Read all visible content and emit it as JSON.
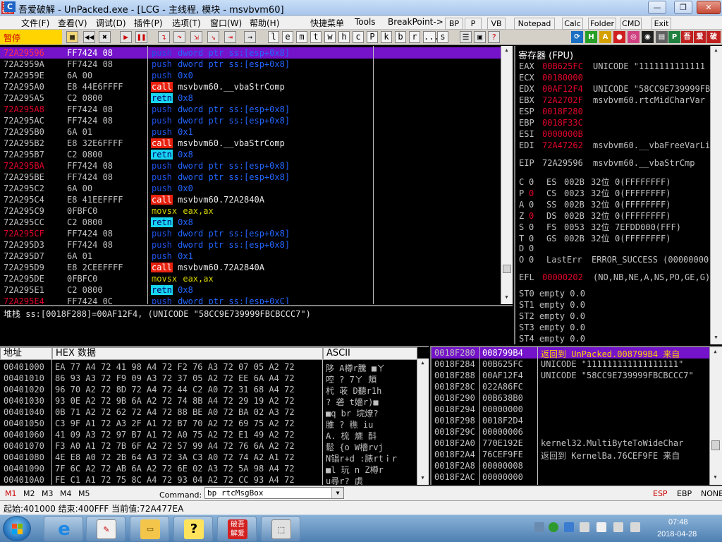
{
  "title": {
    "icon_text": "吾爱破解",
    "text": "吾爱破解 - UnPacked.exe - [LCG - 主线程, 模块 - msvbvm60]",
    "min": "—",
    "max": "❐",
    "close": "✕"
  },
  "menu": {
    "items": [
      "文件(F)",
      "查看(V)",
      "调试(D)",
      "插件(P)",
      "选项(T)",
      "窗口(W)",
      "帮助(H)",
      "快捷菜单",
      "Tools",
      "BreakPoint->"
    ],
    "plugins": [
      "BP",
      "P",
      "VB",
      "Notepad",
      "Calc",
      "Folder",
      "CMD",
      "Exit"
    ]
  },
  "toolbar": {
    "status": "暂停",
    "letters": [
      "l",
      "e",
      "m",
      "t",
      "w",
      "h",
      "c",
      "P",
      "k",
      "b",
      "r",
      "...",
      "s"
    ]
  },
  "disasm": {
    "rows": [
      {
        "addr": "72A29596",
        "bp": true,
        "sel": true,
        "hex": "FF7424 08",
        "op": "push",
        "opnd": "dword ptr ss:[esp+0x8]",
        "kind": "mem"
      },
      {
        "addr": "72A2959A",
        "bp": false,
        "hex": "FF7424 08",
        "op": "push",
        "opnd": "dword ptr ss:[esp+0x8]",
        "kind": "mem"
      },
      {
        "addr": "72A2959E",
        "bp": false,
        "hex": "6A 00",
        "op": "push",
        "opnd": "0x0",
        "kind": "imm"
      },
      {
        "addr": "72A295A0",
        "bp": false,
        "hex": "E8 44E6FFFF",
        "op": "call",
        "opnd": "msvbvm60.__vbaStrComp",
        "kind": "plain"
      },
      {
        "addr": "72A295A5",
        "bp": false,
        "hex": "C2 0800",
        "op": "retn",
        "opnd": "0x8",
        "kind": "imm"
      },
      {
        "addr": "72A295A8",
        "bp": true,
        "hex": "FF7424 08",
        "op": "push",
        "opnd": "dword ptr ss:[esp+0x8]",
        "kind": "mem"
      },
      {
        "addr": "72A295AC",
        "bp": false,
        "hex": "FF7424 08",
        "op": "push",
        "opnd": "dword ptr ss:[esp+0x8]",
        "kind": "mem"
      },
      {
        "addr": "72A295B0",
        "bp": false,
        "hex": "6A 01",
        "op": "push",
        "opnd": "0x1",
        "kind": "imm"
      },
      {
        "addr": "72A295B2",
        "bp": false,
        "hex": "E8 32E6FFFF",
        "op": "call",
        "opnd": "msvbvm60.__vbaStrComp",
        "kind": "plain"
      },
      {
        "addr": "72A295B7",
        "bp": false,
        "hex": "C2 0800",
        "op": "retn",
        "opnd": "0x8",
        "kind": "imm"
      },
      {
        "addr": "72A295BA",
        "bp": true,
        "hex": "FF7424 08",
        "op": "push",
        "opnd": "dword ptr ss:[esp+0x8]",
        "kind": "mem"
      },
      {
        "addr": "72A295BE",
        "bp": false,
        "hex": "FF7424 08",
        "op": "push",
        "opnd": "dword ptr ss:[esp+0x8]",
        "kind": "mem"
      },
      {
        "addr": "72A295C2",
        "bp": false,
        "hex": "6A 00",
        "op": "push",
        "opnd": "0x0",
        "kind": "imm"
      },
      {
        "addr": "72A295C4",
        "bp": false,
        "hex": "E8 41EEFFFF",
        "op": "call",
        "opnd": "msvbvm60.72A2840A",
        "kind": "plain"
      },
      {
        "addr": "72A295C9",
        "bp": false,
        "hex": "0FBFC0",
        "op": "movsx",
        "opnd": "eax,ax",
        "kind": "reg"
      },
      {
        "addr": "72A295CC",
        "bp": false,
        "hex": "C2 0800",
        "op": "retn",
        "opnd": "0x8",
        "kind": "imm"
      },
      {
        "addr": "72A295CF",
        "bp": true,
        "hex": "FF7424 08",
        "op": "push",
        "opnd": "dword ptr ss:[esp+0x8]",
        "kind": "mem"
      },
      {
        "addr": "72A295D3",
        "bp": false,
        "hex": "FF7424 08",
        "op": "push",
        "opnd": "dword ptr ss:[esp+0x8]",
        "kind": "mem"
      },
      {
        "addr": "72A295D7",
        "bp": false,
        "hex": "6A 01",
        "op": "push",
        "opnd": "0x1",
        "kind": "imm"
      },
      {
        "addr": "72A295D9",
        "bp": false,
        "hex": "E8 2CEEFFFF",
        "op": "call",
        "opnd": "msvbvm60.72A2840A",
        "kind": "plain"
      },
      {
        "addr": "72A295DE",
        "bp": false,
        "hex": "0FBFC0",
        "op": "movsx",
        "opnd": "eax,ax",
        "kind": "reg"
      },
      {
        "addr": "72A295E1",
        "bp": false,
        "hex": "C2 0800",
        "op": "retn",
        "opnd": "0x8",
        "kind": "imm"
      },
      {
        "addr": "72A295E4",
        "bp": true,
        "hex": "FF7424 0C",
        "op": "push",
        "opnd": "dword ptr ss:[esp+0xC]",
        "kind": "mem"
      }
    ]
  },
  "info": {
    "text": "堆栈 ss:[0018F288]=00AF12F4, (UNICODE \"58CC9E739999FBCBCCC7\")"
  },
  "registers": {
    "title": "寄存器 (FPU)",
    "general": [
      {
        "name": "EAX",
        "value": "00B625FC",
        "red": true,
        "comment": "UNICODE \"1111111111111"
      },
      {
        "name": "ECX",
        "value": "00180000",
        "red": true,
        "comment": ""
      },
      {
        "name": "EDX",
        "value": "00AF12F4",
        "red": true,
        "comment": "UNICODE \"58CC9E739999FB"
      },
      {
        "name": "EBX",
        "value": "72A2702F",
        "red": true,
        "comment": "msvbvm60.rtcMidCharVar"
      },
      {
        "name": "ESP",
        "value": "0018F280",
        "red": true,
        "comment": ""
      },
      {
        "name": "EBP",
        "value": "0018F33C",
        "red": true,
        "comment": ""
      },
      {
        "name": "ESI",
        "value": "0000000B",
        "red": true,
        "comment": ""
      },
      {
        "name": "EDI",
        "value": "72A47262",
        "red": true,
        "comment": "msvbvm60.__vbaFreeVarLi"
      }
    ],
    "eip": {
      "name": "EIP",
      "value": "72A29596",
      "comment": "msvbvm60.__vbaStrCmp"
    },
    "flags": [
      {
        "f": "C",
        "v": "0",
        "red": false,
        "seg": "ES",
        "sel": "002B",
        "bits": "32位",
        "base": "0(FFFFFFFF)"
      },
      {
        "f": "P",
        "v": "0",
        "red": true,
        "seg": "CS",
        "sel": "0023",
        "bits": "32位",
        "base": "0(FFFFFFFF)"
      },
      {
        "f": "A",
        "v": "0",
        "red": false,
        "seg": "SS",
        "sel": "002B",
        "bits": "32位",
        "base": "0(FFFFFFFF)"
      },
      {
        "f": "Z",
        "v": "0",
        "red": true,
        "seg": "DS",
        "sel": "002B",
        "bits": "32位",
        "base": "0(FFFFFFFF)"
      },
      {
        "f": "S",
        "v": "0",
        "red": false,
        "seg": "FS",
        "sel": "0053",
        "bits": "32位",
        "base": "7EFDD000(FFF)"
      },
      {
        "f": "T",
        "v": "0",
        "red": false,
        "seg": "GS",
        "sel": "002B",
        "bits": "32位",
        "base": "0(FFFFFFFF)"
      },
      {
        "f": "D",
        "v": "0",
        "red": false,
        "seg": "",
        "sel": "",
        "bits": "",
        "base": ""
      },
      {
        "f": "O",
        "v": "0",
        "red": false,
        "seg": "LastErr",
        "sel": "",
        "bits": "",
        "base": "ERROR_SUCCESS (00000000"
      }
    ],
    "efl": {
      "name": "EFL",
      "value": "00000202",
      "comment": "(NO,NB,NE,A,NS,PO,GE,G)"
    },
    "fpu": [
      "ST0 empty 0.0",
      "ST1 empty 0.0",
      "ST2 empty 0.0",
      "ST3 empty 0.0",
      "ST4 empty 0.0"
    ]
  },
  "dump": {
    "header_addr": "地址",
    "header_hex": "HEX 数据",
    "header_ascii": "ASCII",
    "rows": [
      {
        "addr": "00401000",
        "hex": "EA 77 A4 72 41 98 A4 72 F2 76 A3 72 07 05 A2 72",
        "ascii": "陊  A樽r騰  ■ㄚ"
      },
      {
        "addr": "00401010",
        "hex": "86 93 A3 72 F9 09 A3 72 37 05 A2 72 EE 6A A4 72",
        "ascii": "啌  ?  7ㄚ 頬"
      },
      {
        "addr": "00401020",
        "hex": "96 70 A2 72 8D 72 A4 72 44 C2 A0 72 31 68 A4 72",
        "ascii": "杙  荍  D聽r1h"
      },
      {
        "addr": "00401030",
        "hex": "93 0E A2 72 9B 6A A2 72 74 8B A4 72 29 19 A2 72",
        "ascii": "?  砻  t嬙r)■"
      },
      {
        "addr": "00401040",
        "hex": "0B 71 A2 72 62 72 A4 72 88 BE A0 72 BA 02 A3 72",
        "ascii": "■q  br  垸燎?"
      },
      {
        "addr": "00401050",
        "hex": "C3 9F A1 72 A3 2F A1 72 B7 70 A2 72 69 75 A2 72",
        "ascii": "脽  ?  穛  iu"
      },
      {
        "addr": "00401060",
        "hex": "41 09 A3 72 97 B7 A1 72 A0 75 A2 72 E1 49 A2 72",
        "ascii": "A.  梳  爊  酙"
      },
      {
        "addr": "00401070",
        "hex": "F3 A0 A1 72 7B 6F A2 72 57 99 A4 72 76 6A A2 72",
        "ascii": "鬆  {o  W檣rvj"
      },
      {
        "addr": "00401080",
        "hex": "4E E8 A0 72 2B 64 A3 72 3A C3 A0 72 74 A2 A1 72",
        "ascii": "N锠r+d  :脿rtｉr"
      },
      {
        "addr": "00401090",
        "hex": "7F 6C A2 72 AB 6A A2 72 6E 02 A3 72 5A 98 A4 72",
        "ascii": "■l  玩  n  Z樽r"
      },
      {
        "addr": "004010A0",
        "hex": "FE C1 A1 72 75 8C A4 72 93 04 A2 72 CC 93 A4 72",
        "ascii": "  u尋r?  虡"
      }
    ]
  },
  "stack": {
    "rows": [
      {
        "addr": "0018F280",
        "val": "008799B4",
        "cmt": "返回到 UnPacked.008799B4 来自",
        "sel": true
      },
      {
        "addr": "0018F284",
        "val": "00B625FC",
        "cmt": "UNICODE \"111111111111111111\""
      },
      {
        "addr": "0018F288",
        "val": "00AF12F4",
        "cmt": "UNICODE \"58CC9E739999FBCBCCC7\""
      },
      {
        "addr": "0018F28C",
        "val": "022A86FC",
        "cmt": ""
      },
      {
        "addr": "0018F290",
        "val": "00B638B0",
        "cmt": ""
      },
      {
        "addr": "0018F294",
        "val": "00000000",
        "cmt": ""
      },
      {
        "addr": "0018F298",
        "val": "0018F2D4",
        "cmt": ""
      },
      {
        "addr": "0018F29C",
        "val": "00000006",
        "cmt": ""
      },
      {
        "addr": "0018F2A0",
        "val": "770E192E",
        "cmt": "kernel32.MultiByteToWideChar"
      },
      {
        "addr": "0018F2A4",
        "val": "76CEF9FE",
        "cmt": "返回到 KernelBa.76CEF9FE 来自"
      },
      {
        "addr": "0018F2A8",
        "val": "00000008",
        "cmt": ""
      },
      {
        "addr": "0018F2AC",
        "val": "00000000",
        "cmt": ""
      }
    ]
  },
  "cmd": {
    "tabs": [
      "M1",
      "M2",
      "M3",
      "M4",
      "M5"
    ],
    "label": "Command:",
    "value": "bp rtcMsgBox",
    "right": [
      "ESP",
      "EBP",
      "NONE"
    ]
  },
  "status": {
    "text": "起始:401000 结束:400FFF 当前值:72A477EA"
  },
  "taskbar": {
    "time": "07:48",
    "date": "2018-04-28",
    "pinned_label": "破吾解爱"
  }
}
